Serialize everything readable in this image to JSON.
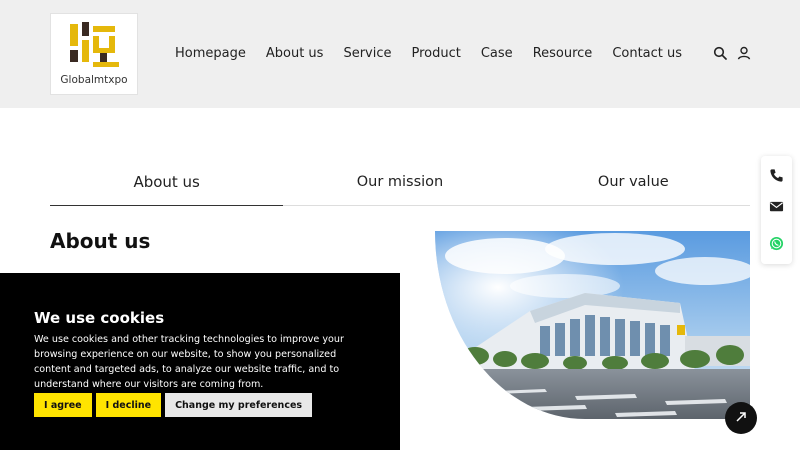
{
  "brand": {
    "name": "Globalmtxpo"
  },
  "nav": {
    "items": [
      "Homepage",
      "About us",
      "Service",
      "Product",
      "Case",
      "Resource",
      "Contact us"
    ]
  },
  "header_icons": [
    "search-icon",
    "user-icon"
  ],
  "tabs": [
    {
      "label": "About us",
      "active": true
    },
    {
      "label": "Our mission",
      "active": false
    },
    {
      "label": "Our value",
      "active": false
    }
  ],
  "section": {
    "title": "About us"
  },
  "side_contact": [
    "phone-icon",
    "mail-icon",
    "whatsapp-icon"
  ],
  "cookie": {
    "title": "We use cookies",
    "text": "We use cookies and other tracking technologies to improve your browsing experience on our website, to show you personalized content and targeted ads, to analyze our website traffic, and to understand where our visitors are coming from.",
    "agree": "I agree",
    "decline": "I decline",
    "preferences": "Change my preferences"
  },
  "colors": {
    "accent": "#ffe400",
    "brand_gold": "#e5b80b",
    "header_bg": "#efefef"
  }
}
